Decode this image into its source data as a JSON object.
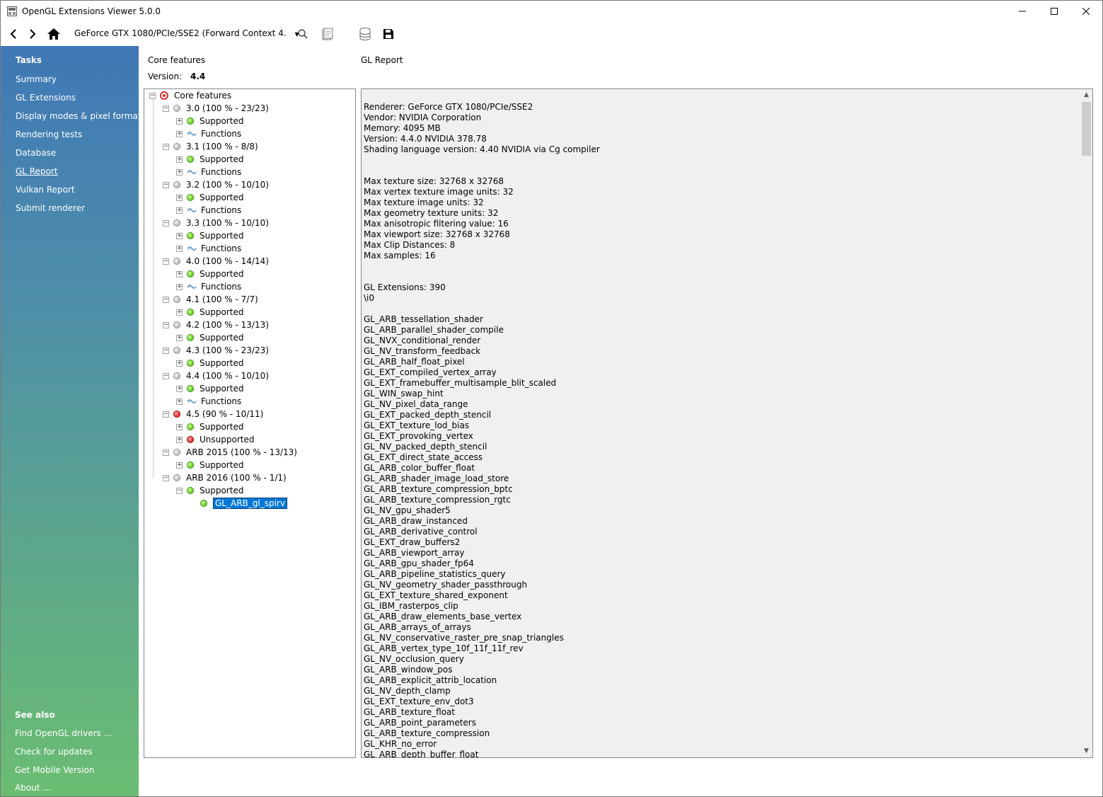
{
  "window": {
    "title": "OpenGL Extensions Viewer 5.0.0"
  },
  "toolbar": {
    "renderer": "GeForce GTX 1080/PCIe/SSE2  (Forward Context 4."
  },
  "sidebar": {
    "tasks_heading": "Tasks",
    "tasks": [
      {
        "label": "Summary"
      },
      {
        "label": "GL Extensions"
      },
      {
        "label": "Display modes & pixel formats"
      },
      {
        "label": "Rendering tests"
      },
      {
        "label": "Database"
      },
      {
        "label": "GL Report"
      },
      {
        "label": "Vulkan Report"
      },
      {
        "label": "Submit renderer"
      }
    ],
    "see_also_heading": "See also",
    "see_also": [
      {
        "label": "Find OpenGL drivers ..."
      },
      {
        "label": "Check for updates"
      },
      {
        "label": "Get Mobile Version"
      },
      {
        "label": "About ..."
      }
    ]
  },
  "main": {
    "core_features_label": "Core features",
    "version_label": "Version:",
    "version_value": "4.4",
    "gl_report_label": "GL Report"
  },
  "tree": {
    "root": "Core features",
    "nodes": [
      {
        "text": "3.0 (100 % - 23/23)",
        "status": "gray",
        "expanded": true
      },
      {
        "text": "Supported",
        "status": "green"
      },
      {
        "text": "Functions",
        "status": "fn"
      },
      {
        "text": "3.1 (100 % - 8/8)",
        "status": "gray",
        "expanded": true
      },
      {
        "text": "Supported",
        "status": "green"
      },
      {
        "text": "Functions",
        "status": "fn"
      },
      {
        "text": "3.2 (100 % - 10/10)",
        "status": "gray",
        "expanded": true
      },
      {
        "text": "Supported",
        "status": "green"
      },
      {
        "text": "Functions",
        "status": "fn"
      },
      {
        "text": "3.3 (100 % - 10/10)",
        "status": "gray",
        "expanded": true
      },
      {
        "text": "Supported",
        "status": "green"
      },
      {
        "text": "Functions",
        "status": "fn"
      },
      {
        "text": "4.0 (100 % - 14/14)",
        "status": "gray",
        "expanded": true
      },
      {
        "text": "Supported",
        "status": "green"
      },
      {
        "text": "Functions",
        "status": "fn"
      },
      {
        "text": "4.1 (100 % - 7/7)",
        "status": "gray",
        "expanded": true
      },
      {
        "text": "Supported",
        "status": "green"
      },
      {
        "text": "4.2 (100 % - 13/13)",
        "status": "gray",
        "expanded": true
      },
      {
        "text": "Supported",
        "status": "green"
      },
      {
        "text": "4.3 (100 % - 23/23)",
        "status": "gray",
        "expanded": true
      },
      {
        "text": "Supported",
        "status": "green"
      },
      {
        "text": "4.4 (100 % - 10/10)",
        "status": "gray",
        "expanded": true
      },
      {
        "text": "Supported",
        "status": "green"
      },
      {
        "text": "Functions",
        "status": "fn"
      },
      {
        "text": "4.5 (90 % - 10/11)",
        "status": "red",
        "expanded": true
      },
      {
        "text": "Supported",
        "status": "green"
      },
      {
        "text": "Unsupported",
        "status": "red"
      },
      {
        "text": "ARB 2015 (100 % - 13/13)",
        "status": "gray",
        "expanded": true
      },
      {
        "text": "Supported",
        "status": "green"
      },
      {
        "text": "ARB 2016 (100 % - 1/1)",
        "status": "gray",
        "expanded": true
      },
      {
        "text": "Supported",
        "status": "green",
        "expanded": true
      },
      {
        "text": "GL_ARB_gl_spirv",
        "status": "green",
        "selected": true
      }
    ]
  },
  "report": {
    "lines": [
      "Renderer: GeForce GTX 1080/PCIe/SSE2",
      "Vendor: NVIDIA Corporation",
      "Memory: 4095 MB",
      "Version: 4.4.0 NVIDIA 378.78",
      "Shading language version: 4.40 NVIDIA via Cg compiler",
      "",
      "",
      "Max texture size: 32768 x 32768",
      "Max vertex texture image units: 32",
      "Max texture image units: 32",
      "Max geometry texture units: 32",
      "Max anisotropic filtering value: 16",
      "Max viewport size: 32768 x 32768",
      "Max Clip Distances: 8",
      "Max samples: 16",
      "",
      "",
      "GL Extensions: 390",
      "\\i0",
      "",
      "GL_ARB_tessellation_shader",
      "GL_ARB_parallel_shader_compile",
      "GL_NVX_conditional_render",
      "GL_NV_transform_feedback",
      "GL_ARB_half_float_pixel",
      "GL_EXT_compiled_vertex_array",
      "GL_EXT_framebuffer_multisample_blit_scaled",
      "GL_WIN_swap_hint",
      "GL_NV_pixel_data_range",
      "GL_EXT_packed_depth_stencil",
      "GL_EXT_texture_lod_bias",
      "GL_EXT_provoking_vertex",
      "GL_NV_packed_depth_stencil",
      "GL_EXT_direct_state_access",
      "GL_ARB_color_buffer_float",
      "GL_ARB_shader_image_load_store",
      "GL_ARB_texture_compression_bptc",
      "GL_ARB_texture_compression_rgtc",
      "GL_NV_gpu_shader5",
      "GL_ARB_draw_instanced",
      "GL_ARB_derivative_control",
      "GL_EXT_draw_buffers2",
      "GL_ARB_viewport_array",
      "GL_ARB_gpu_shader_fp64",
      "GL_ARB_pipeline_statistics_query",
      "GL_NV_geometry_shader_passthrough",
      "GL_EXT_texture_shared_exponent",
      "GL_IBM_rasterpos_clip",
      "GL_ARB_draw_elements_base_vertex",
      "GL_ARB_arrays_of_arrays",
      "GL_NV_conservative_raster_pre_snap_triangles",
      "GL_ARB_vertex_type_10f_11f_11f_rev",
      "GL_NV_occlusion_query",
      "GL_ARB_window_pos",
      "GL_ARB_explicit_attrib_location",
      "GL_NV_depth_clamp",
      "GL_EXT_texture_env_dot3",
      "GL_ARB_texture_float",
      "GL_ARB_point_parameters",
      "GL_ARB_texture_compression",
      "GL_KHR_no_error",
      "GL_ARB_depth_buffer_float"
    ]
  }
}
